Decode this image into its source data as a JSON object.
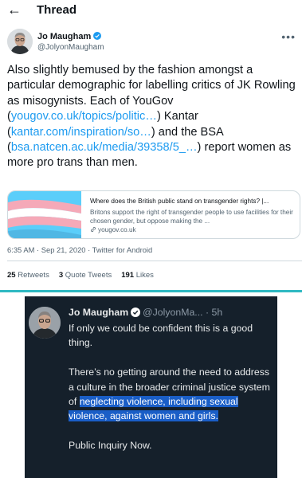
{
  "header": {
    "back_icon": "arrow-left-icon",
    "title": "Thread"
  },
  "tweet": {
    "author_name": "Jo Maugham",
    "author_handle": "@JolyonMaugham",
    "more_icon": "more-icon",
    "text": {
      "part1": "Also slightly bemused by the fashion amongst a particular demographic for labelling critics of JK Rowling as misogynists. Each of YouGov (",
      "link1": "yougov.co.uk/topics/politic…",
      "part2": ") Kantar (",
      "link2": "kantar.com/inspiration/so…",
      "part3": ") and the BSA (",
      "link3": "bsa.natcen.ac.uk/media/39358/5_…",
      "part4": ") report women as more pro trans than men."
    },
    "card": {
      "title": "Where does the British public stand on transgender rights? |...",
      "description": "Britons support the right of transgender people to use facilities for their chosen gender, but oppose making the ...",
      "domain": "yougov.co.uk",
      "image_colors": [
        "#5bcefa",
        "#f5a9b8",
        "#ffffff"
      ]
    },
    "timestamp": "6:35 AM · Sep 21, 2020 · Twitter for Android",
    "stats": {
      "retweets_count": "25",
      "retweets_label": "Retweets",
      "quote_count": "3",
      "quote_label": "Quote Tweets",
      "likes_count": "191",
      "likes_label": "Likes"
    }
  },
  "reply": {
    "author_name": "Jo Maugham",
    "author_handle": "@JolyonMa...",
    "time": "· 5h",
    "para1": "If only we could be confident this is a good thing.",
    "para2_plain": "There’s no getting around the need to address a culture in the broader criminal justice system of ",
    "para2_highlight": "neglecting violence, including sexual violence, against women and girls.",
    "para3": "Public Inquiry Now."
  },
  "colors": {
    "link": "#1d9bf0",
    "dark_bg": "#15202b",
    "highlight": "#1a5ec7",
    "accent_line": "#2fb9c2"
  }
}
